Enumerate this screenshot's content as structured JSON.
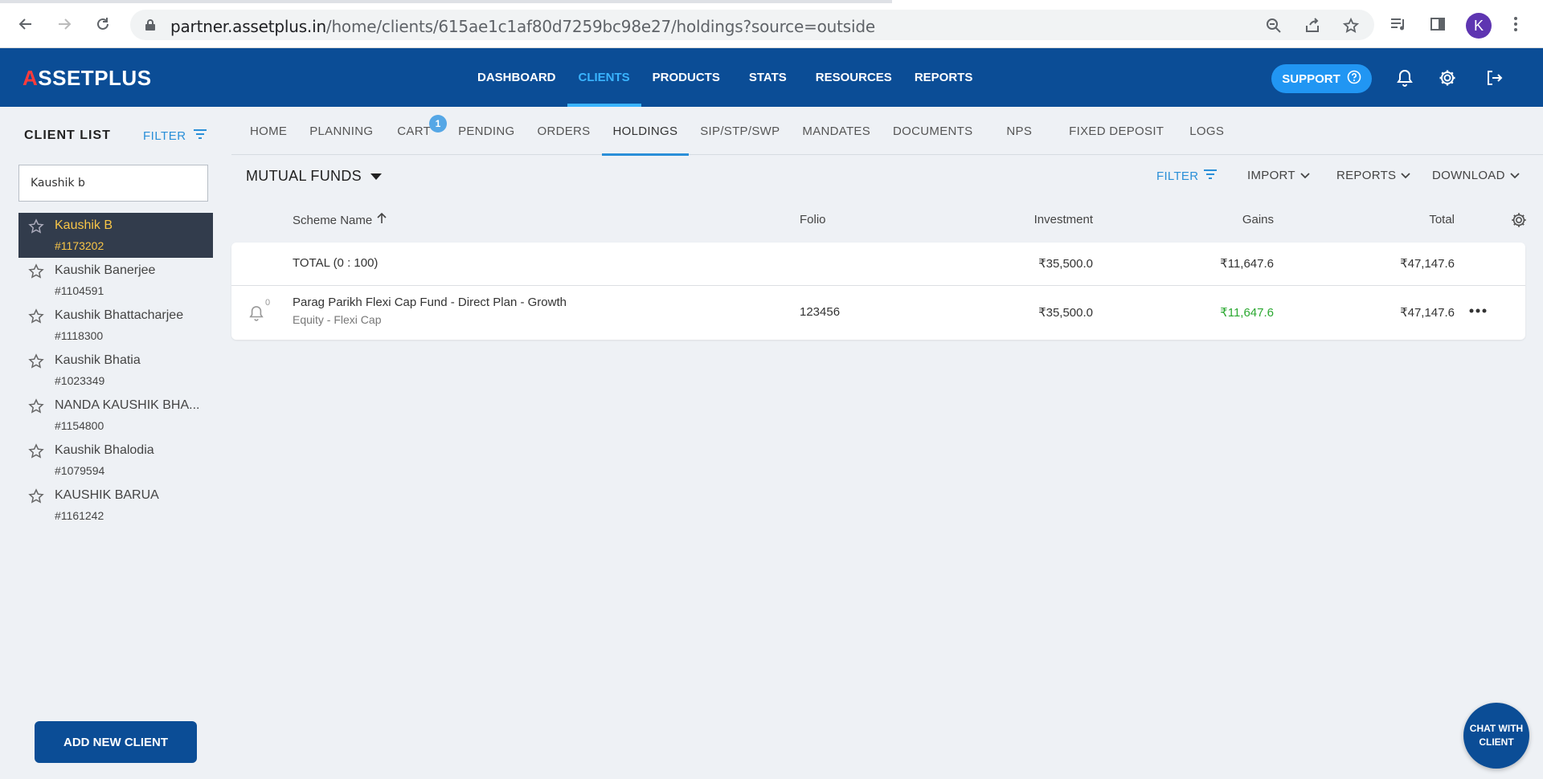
{
  "browser": {
    "url_domain": "partner.assetplus.in",
    "url_path": "/home/clients/615ae1c1af80d7259bc98e27/holdings?source=outside",
    "avatar_letter": "K"
  },
  "header": {
    "logo": "SSETPLUS",
    "logo_mark": "A",
    "nav": [
      {
        "label": "DASHBOARD"
      },
      {
        "label": "CLIENTS",
        "active": true
      },
      {
        "label": "PRODUCTS"
      },
      {
        "label": "STATS"
      },
      {
        "label": "RESOURCES"
      },
      {
        "label": "REPORTS"
      }
    ],
    "support_label": "SUPPORT"
  },
  "sidebar": {
    "title": "CLIENT LIST",
    "filter_label": "FILTER",
    "search_value": "Kaushik b",
    "clients": [
      {
        "name": "Kaushik B",
        "id": "#1173202",
        "selected": true
      },
      {
        "name": "Kaushik Banerjee",
        "id": "#1104591"
      },
      {
        "name": "Kaushik Bhattacharjee",
        "id": "#1118300"
      },
      {
        "name": "Kaushik Bhatia",
        "id": "#1023349"
      },
      {
        "name": "NANDA KAUSHIK BHA...",
        "id": "#1154800"
      },
      {
        "name": "Kaushik Bhalodia",
        "id": "#1079594"
      },
      {
        "name": "KAUSHIK BARUA",
        "id": "#1161242"
      }
    ],
    "add_client_label": "ADD NEW CLIENT"
  },
  "tabs": [
    {
      "label": "HOME"
    },
    {
      "label": "PLANNING"
    },
    {
      "label": "CART",
      "badge": "1"
    },
    {
      "label": "PENDING"
    },
    {
      "label": "ORDERS"
    },
    {
      "label": "HOLDINGS",
      "active": true
    },
    {
      "label": "SIP/STP/SWP"
    },
    {
      "label": "MANDATES"
    },
    {
      "label": "DOCUMENTS"
    },
    {
      "label": "NPS"
    },
    {
      "label": "FIXED DEPOSIT"
    },
    {
      "label": "LOGS"
    }
  ],
  "holdings": {
    "section_title": "MUTUAL FUNDS",
    "toolbar": {
      "filter": "FILTER",
      "import": "IMPORT",
      "reports": "REPORTS",
      "download": "DOWNLOAD"
    },
    "columns": {
      "scheme": "Scheme Name",
      "folio": "Folio",
      "investment": "Investment",
      "gains": "Gains",
      "total": "Total"
    },
    "total_row": {
      "label": "TOTAL (0 : 100)",
      "investment": "₹35,500.0",
      "gains": "₹11,647.6",
      "total": "₹47,147.6"
    },
    "rows": [
      {
        "scheme": "Parag Parikh Flexi Cap Fund - Direct Plan - Growth",
        "category": "Equity - Flexi Cap",
        "folio": "123456",
        "investment": "₹35,500.0",
        "gains": "₹11,647.6",
        "total": "₹47,147.6",
        "alerts": "0"
      }
    ]
  },
  "chat_label": "CHAT WITH CLIENT",
  "colors": {
    "brand": "#0b4d96",
    "accent": "#3ab4ff",
    "gain": "#2aa830",
    "selected_client": "#f8c547"
  }
}
